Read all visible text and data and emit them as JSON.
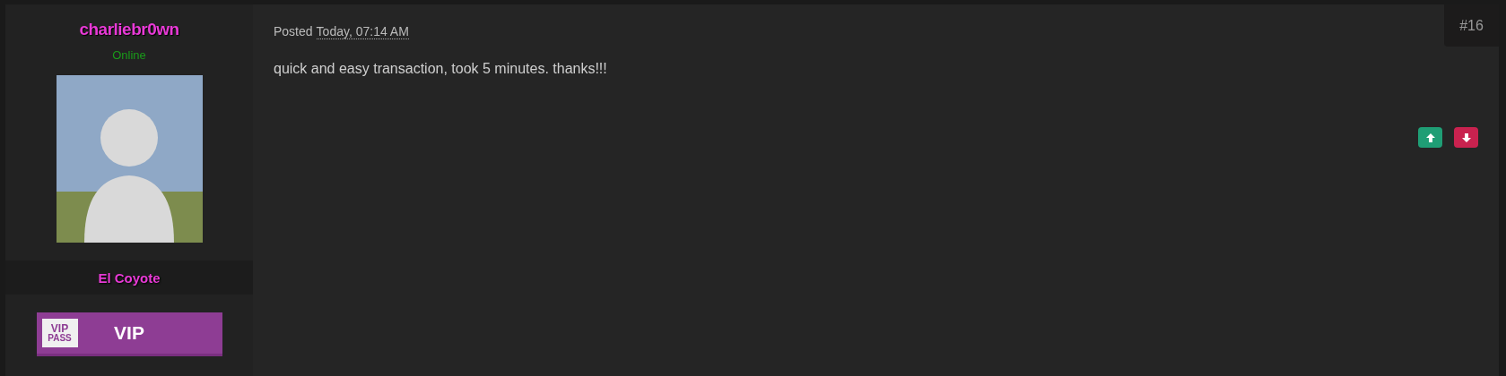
{
  "author": {
    "username": "charliebr0wn",
    "status": "Online",
    "group": "El Coyote",
    "badge": {
      "ticket_top": "VIP",
      "ticket_bottom": "PASS",
      "label": "VIP"
    }
  },
  "post": {
    "posted_label": "Posted",
    "date": "Today, 07:14 AM",
    "number": "#16",
    "body": "quick and easy transaction, took 5 minutes. thanks!!!"
  }
}
